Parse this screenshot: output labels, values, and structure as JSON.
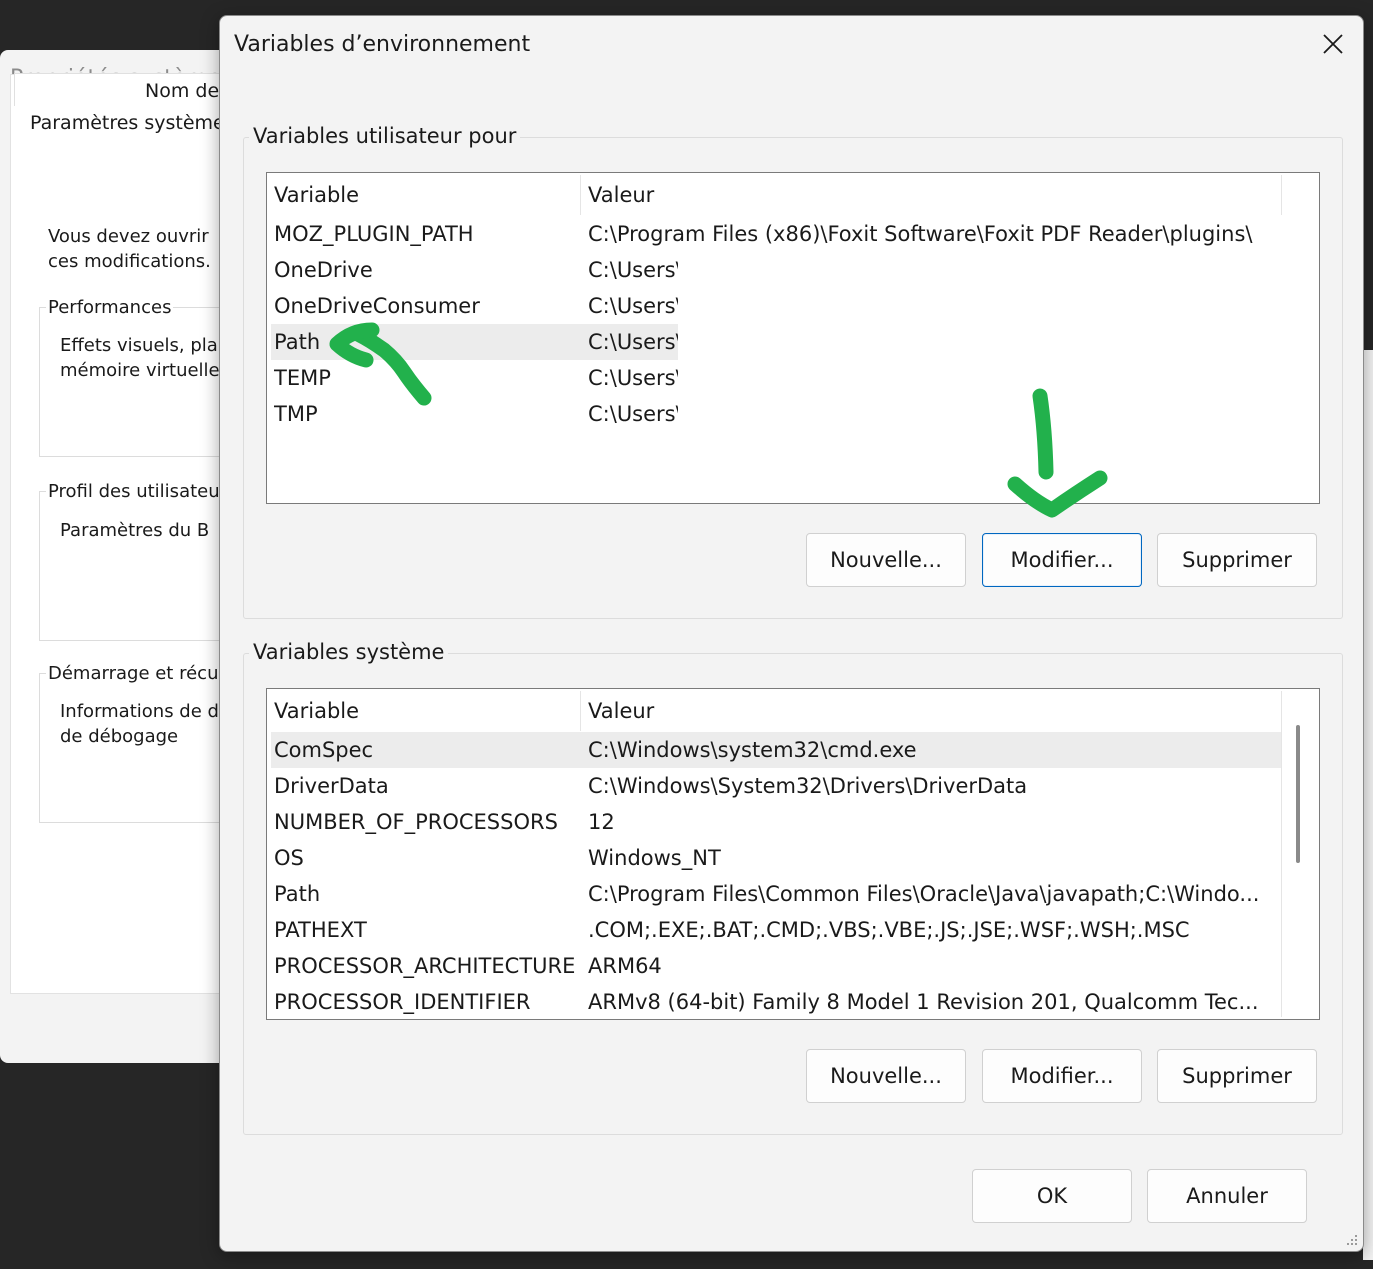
{
  "background_window": {
    "title": "Propriétés système",
    "tab_label": "Nom de",
    "heading": "Paramètres système",
    "admin_note_line1": "Vous devez ouvrir",
    "admin_note_line2": "ces modifications.",
    "groups": [
      {
        "label": "Performances",
        "line1": "Effets visuels, pla",
        "line2": "mémoire virtuelle"
      },
      {
        "label": "Profil des utilisateu",
        "line1": "Paramètres du B",
        "line2": ""
      },
      {
        "label": "Démarrage et récu",
        "line1": "Informations de d",
        "line2": "de débogage"
      }
    ]
  },
  "dialog": {
    "title": "Variables d’environnement",
    "close_icon": "close-icon",
    "user_section": {
      "label": "Variables utilisateur pour",
      "columns": [
        "Variable",
        "Valeur"
      ],
      "rows": [
        {
          "name": "MOZ_PLUGIN_PATH",
          "value": "C:\\Program Files (x86)\\Foxit Software\\Foxit PDF Reader\\plugins\\"
        },
        {
          "name": "OneDrive",
          "value": "C:\\Users\\"
        },
        {
          "name": "OneDriveConsumer",
          "value": "C:\\Users\\"
        },
        {
          "name": "Path",
          "value": "C:\\Users\\"
        },
        {
          "name": "TEMP",
          "value": "C:\\Users\\"
        },
        {
          "name": "TMP",
          "value": "C:\\Users\\"
        }
      ],
      "selected_row": "Path",
      "buttons": {
        "new": "Nouvelle...",
        "edit": "Modifier...",
        "delete": "Supprimer"
      }
    },
    "system_section": {
      "label": "Variables système",
      "columns": [
        "Variable",
        "Valeur"
      ],
      "rows": [
        {
          "name": "ComSpec",
          "value": "C:\\Windows\\system32\\cmd.exe"
        },
        {
          "name": "DriverData",
          "value": "C:\\Windows\\System32\\Drivers\\DriverData"
        },
        {
          "name": "NUMBER_OF_PROCESSORS",
          "value": "12"
        },
        {
          "name": "OS",
          "value": "Windows_NT"
        },
        {
          "name": "Path",
          "value": "C:\\Program Files\\Common Files\\Oracle\\Java\\javapath;C:\\Windo..."
        },
        {
          "name": "PATHEXT",
          "value": ".COM;.EXE;.BAT;.CMD;.VBS;.VBE;.JS;.JSE;.WSF;.WSH;.MSC"
        },
        {
          "name": "PROCESSOR_ARCHITECTURE",
          "value": "ARM64"
        },
        {
          "name": "PROCESSOR_IDENTIFIER",
          "value": "ARMv8 (64-bit) Family 8 Model 1 Revision 201, Qualcomm Tec..."
        }
      ],
      "selected_row": "ComSpec",
      "buttons": {
        "new": "Nouvelle...",
        "edit": "Modifier...",
        "delete": "Supprimer"
      }
    },
    "ok_label": "OK",
    "cancel_label": "Annuler"
  },
  "annotations": {
    "color": "#22b14c",
    "arrow_to_path_row": "arrow-left-annotation",
    "arrow_to_edit_button": "arrow-down-annotation"
  }
}
